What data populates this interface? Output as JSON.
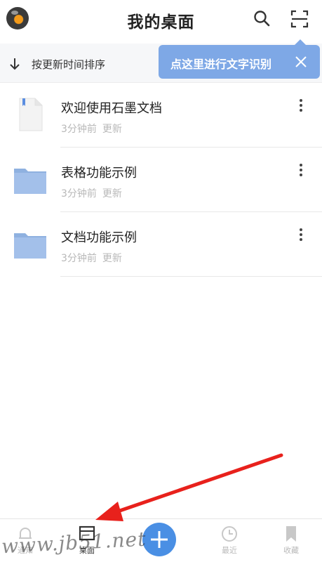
{
  "header": {
    "title": "我的桌面",
    "avatar_icon": "orange-avatar-icon",
    "search_icon": "search-icon",
    "scan_icon": "scan-frame-icon"
  },
  "sortbar": {
    "label": "按更新时间排序",
    "icon": "arrow-down-icon"
  },
  "tooltip": {
    "text": "点这里进行文字识别",
    "close_icon": "close-icon",
    "color": "#7ea8e6"
  },
  "files": [
    {
      "name": "欢迎使用石墨文档",
      "time": "3分钟前",
      "action": "更新",
      "type": "document"
    },
    {
      "name": "表格功能示例",
      "time": "3分钟前",
      "action": "更新",
      "type": "folder"
    },
    {
      "name": "文档功能示例",
      "time": "3分钟前",
      "action": "更新",
      "type": "folder"
    }
  ],
  "tabbar": {
    "notify": "通知",
    "desktop": "桌面",
    "recent": "最近",
    "favorites": "收藏",
    "add_icon": "plus-icon",
    "accent": "#4a8fe4"
  },
  "watermark": "www.jb51.net"
}
